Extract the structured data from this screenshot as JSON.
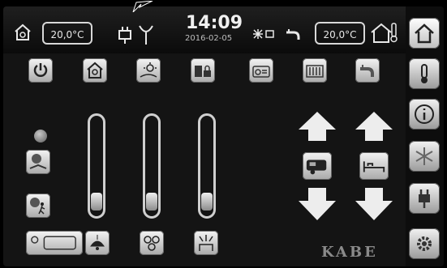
{
  "topbar": {
    "inside_temp": "20,0°C",
    "outside_temp": "20,0°C",
    "time": "14:09",
    "date": "2016-02-05"
  },
  "brand": {
    "logo_text": "KABE"
  },
  "sidebar": {
    "items": [
      {
        "name": "home-icon",
        "active": true
      },
      {
        "name": "thermometer-icon"
      },
      {
        "name": "info-icon"
      },
      {
        "name": "snowflake-icon"
      },
      {
        "name": "plug-icon"
      },
      {
        "name": "gear-icon"
      }
    ]
  },
  "toggles": {
    "power": "power-icon",
    "house_light": "house-light-icon",
    "outdoor_light": "outdoor-light-icon",
    "battery_lock": "battery-lock-icon",
    "radio": "radio-icon",
    "heater": "heater-icon",
    "water": "water-icon"
  },
  "sliders": [
    {
      "name": "ceiling-lamp-dimmer",
      "level": 0.05
    },
    {
      "name": "spot-lights-dimmer",
      "level": 0.05
    },
    {
      "name": "ambient-light-dimmer",
      "level": 0.05
    }
  ],
  "colors": {
    "background": "#141414",
    "button_light": "#f2f2f2",
    "button_dark": "#9a9a9a",
    "text": "#e8e8e8"
  }
}
